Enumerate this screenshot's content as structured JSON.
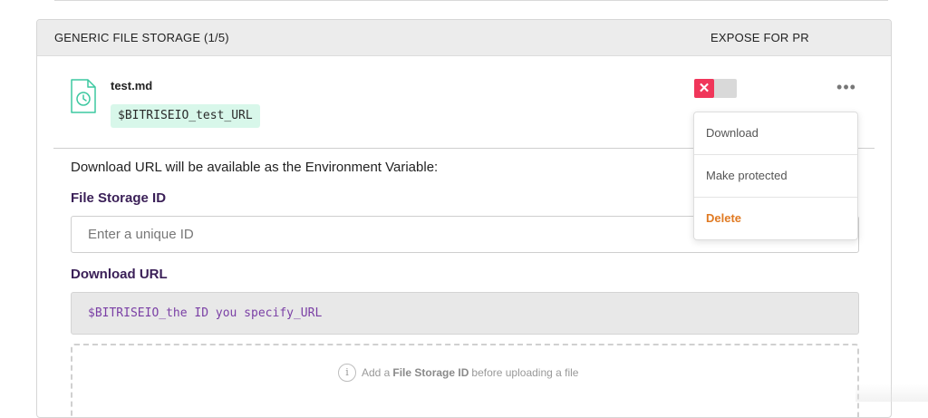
{
  "section": {
    "title": "GENERIC FILE STORAGE (1/5)",
    "expose_header": "EXPOSE FOR PR"
  },
  "file": {
    "name": "test.md",
    "env_var": "$BITRISEIO_test_URL",
    "icon": "file-clock-icon",
    "expose_toggle": {
      "state": "off",
      "icon": "close-icon",
      "glyph": "✕",
      "accent": "#f0365a"
    },
    "more_glyph": "•••"
  },
  "menu": {
    "items": [
      {
        "label": "Download",
        "style": "normal"
      },
      {
        "label": "Make protected",
        "style": "normal"
      },
      {
        "label": "Delete",
        "style": "danger",
        "color": "#e07a23"
      }
    ]
  },
  "form": {
    "helper_text": "Download URL will be available as the Environment Variable:",
    "storage_id_label": "File Storage ID",
    "storage_id_placeholder": "Enter a unique ID",
    "download_url_label": "Download URL",
    "download_url_value": "$BITRISEIO_the ID you specify_URL",
    "upload_hint_prefix": "Add a",
    "upload_hint_bold": "File Storage ID",
    "upload_hint_suffix": "before uploading a file",
    "info_glyph": "i"
  },
  "colors": {
    "badge_bg": "#d8f7ea",
    "label_purple": "#3a1f57",
    "url_text": "#7a3fa5"
  }
}
